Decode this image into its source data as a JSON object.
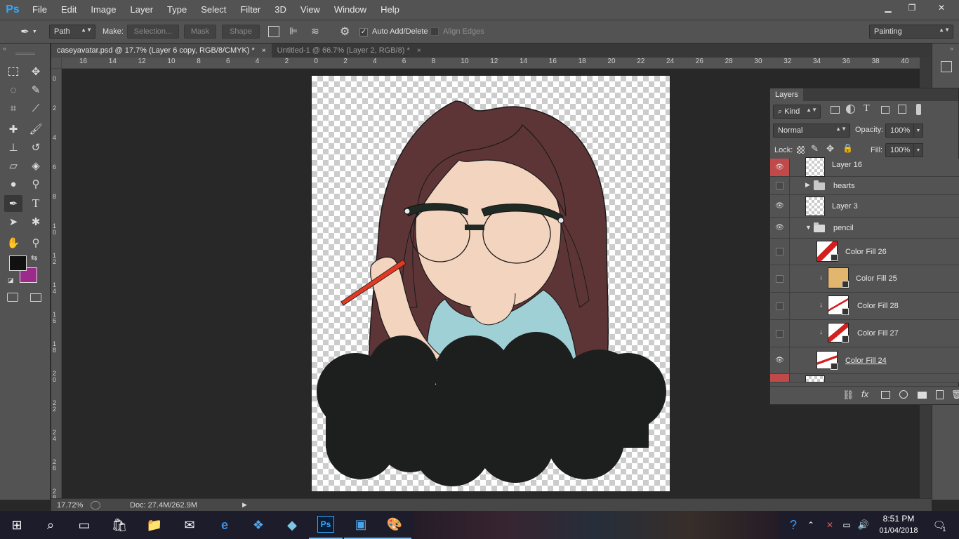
{
  "app": {
    "logo": "Ps"
  },
  "menu": [
    "File",
    "Edit",
    "Image",
    "Layer",
    "Type",
    "Select",
    "Filter",
    "3D",
    "View",
    "Window",
    "Help"
  ],
  "window_controls": {
    "minimize": "▁",
    "restore": "❐",
    "close": "✕"
  },
  "options": {
    "mode": "Path",
    "make_label": "Make:",
    "selection": "Selection...",
    "mask": "Mask",
    "shape": "Shape",
    "auto_add_delete": "Auto Add/Delete",
    "align_edges": "Align Edges",
    "workspace": "Painting"
  },
  "tabs": [
    {
      "title": "caseyavatar.psd @ 17.7% (Layer 6 copy, RGB/8/CMYK) *",
      "close": "×"
    },
    {
      "title": "Untitled-1 @ 66.7% (Layer 2, RGB/8) *",
      "close": "×"
    }
  ],
  "ruler_top": [
    "16",
    "14",
    "12",
    "10",
    "8",
    "6",
    "4",
    "2",
    "0",
    "2",
    "4",
    "6",
    "8",
    "10",
    "12",
    "14",
    "16",
    "18",
    "20",
    "22",
    "24",
    "26",
    "28",
    "30",
    "32",
    "34",
    "36",
    "38",
    "40"
  ],
  "ruler_left": [
    "0",
    "2",
    "4",
    "6",
    "8",
    "1 0",
    "1 2",
    "1 4",
    "1 6",
    "1 8",
    "2 0",
    "2 2",
    "2 4",
    "2 6",
    "2 8"
  ],
  "status": {
    "zoom": "17.72%",
    "doc": "Doc: 27.4M/262.9M"
  },
  "colors": {
    "foreground": "#111111",
    "background": "#9b2a8a",
    "hair": "#5e3537",
    "skin": "#f3d4bf",
    "shirt": "#9fd0d6",
    "cloud": "#1d1f1e",
    "pencil": "#e23a22"
  },
  "layers_panel": {
    "tab": "Layers",
    "kind": "Kind",
    "blend_mode": "Normal",
    "opacity_label": "Opacity:",
    "opacity": "100%",
    "lock_label": "Lock:",
    "fill_label": "Fill:",
    "fill": "100%",
    "layers": [
      {
        "name": "Layer 16",
        "visible": true
      },
      {
        "name": "hearts",
        "visible": false
      },
      {
        "name": "Layer 3",
        "visible": true
      },
      {
        "name": "pencil",
        "visible": true
      },
      {
        "name": "Color Fill 26",
        "visible": false
      },
      {
        "name": "Color Fill 25",
        "visible": false
      },
      {
        "name": "Color Fill 28",
        "visible": false
      },
      {
        "name": "Color Fill 27",
        "visible": false
      },
      {
        "name": "Color Fill 24",
        "visible": true
      }
    ]
  },
  "taskbar": {
    "time": "8:51 PM",
    "date": "01/04/2018",
    "notifications": "1"
  }
}
